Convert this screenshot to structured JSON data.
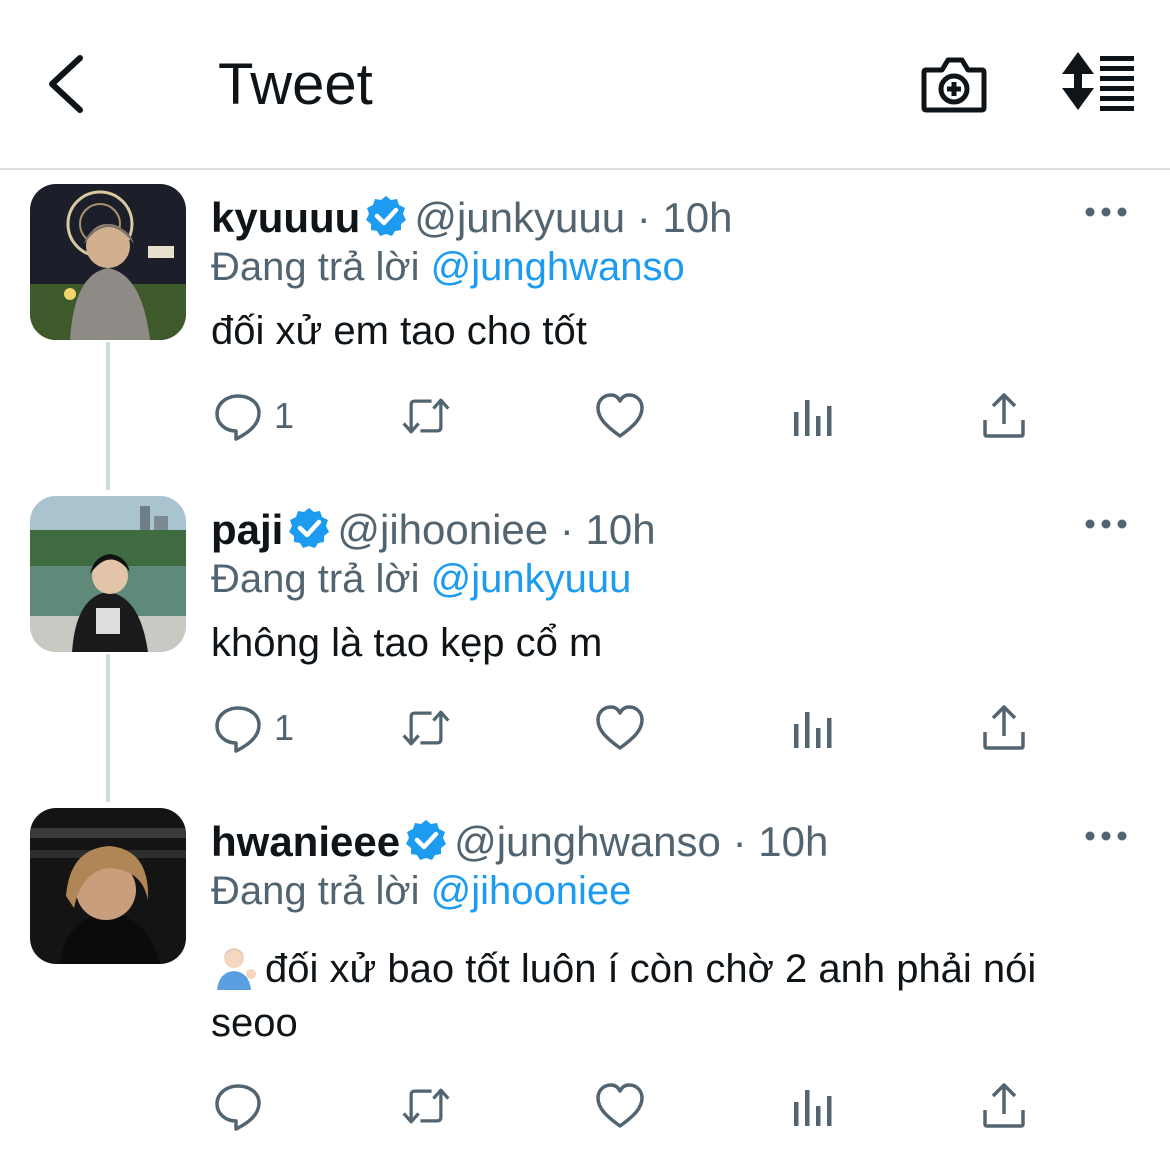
{
  "header": {
    "title": "Tweet",
    "icons": [
      "back-arrow-icon",
      "camera-add-icon",
      "sort-toggle-icon"
    ]
  },
  "reply_prefix": "Đang trả lời",
  "tweets": [
    {
      "name": "kyuuuu",
      "handle": "@junkyuuu",
      "dot": "·",
      "time": "10h",
      "replying_to": "@junghwanso",
      "text": "đối xử em tao cho tốt",
      "reply_count": "1",
      "verified": true
    },
    {
      "name": "paji",
      "handle": "@jihooniee",
      "dot": "·",
      "time": "10h",
      "replying_to": "@junkyuuu",
      "text": "không là tao kẹp cổ m",
      "reply_count": "1",
      "verified": true
    },
    {
      "name": "hwanieee",
      "handle": "@junghwanso",
      "dot": "·",
      "time": "10h",
      "replying_to": "@jihooniee",
      "text_line1": "đối xử bao tốt luôn í còn chờ 2 anh phải nói",
      "text_line2": "seoo",
      "reply_count": "",
      "verified": true
    }
  ],
  "colors": {
    "accent": "#1d9bf0",
    "secondary_text": "#536471",
    "primary_text": "#0f1419",
    "thread_line": "#cfd9de"
  }
}
